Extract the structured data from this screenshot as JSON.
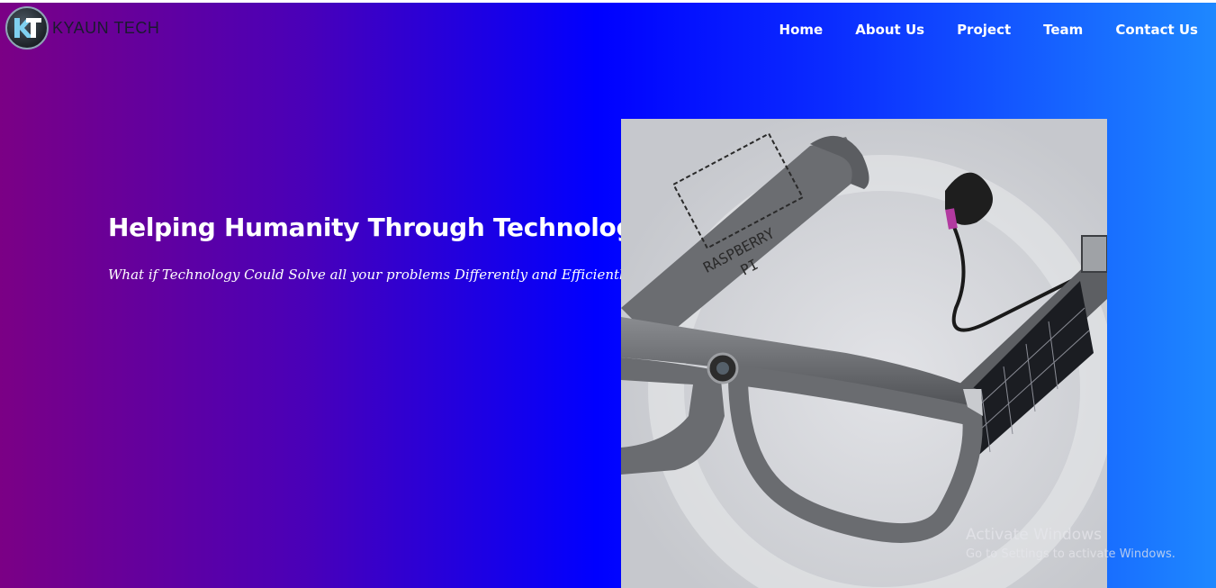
{
  "brand": {
    "name": "KYAUN TECH",
    "logo_icon": "kt-logo-icon"
  },
  "nav": {
    "items": [
      {
        "label": "Home"
      },
      {
        "label": "About Us"
      },
      {
        "label": "Project"
      },
      {
        "label": "Team"
      },
      {
        "label": "Contact Us"
      }
    ]
  },
  "hero": {
    "title": "Helping Humanity Through Technology",
    "subtitle": "What if Technology Could Solve all your problems Differently and Efficiently",
    "image": {
      "depicts": "smart-glasses",
      "temple_label": [
        "RASPBERRY",
        "PI"
      ]
    }
  },
  "watermark": {
    "title": "Activate Windows",
    "subtitle": "Go to Settings to activate Windows."
  },
  "colors": {
    "gradient_left": "#7b0085",
    "gradient_mid": "#0000ff",
    "gradient_right": "#1e88ff",
    "nav_text": "#ffffff"
  }
}
